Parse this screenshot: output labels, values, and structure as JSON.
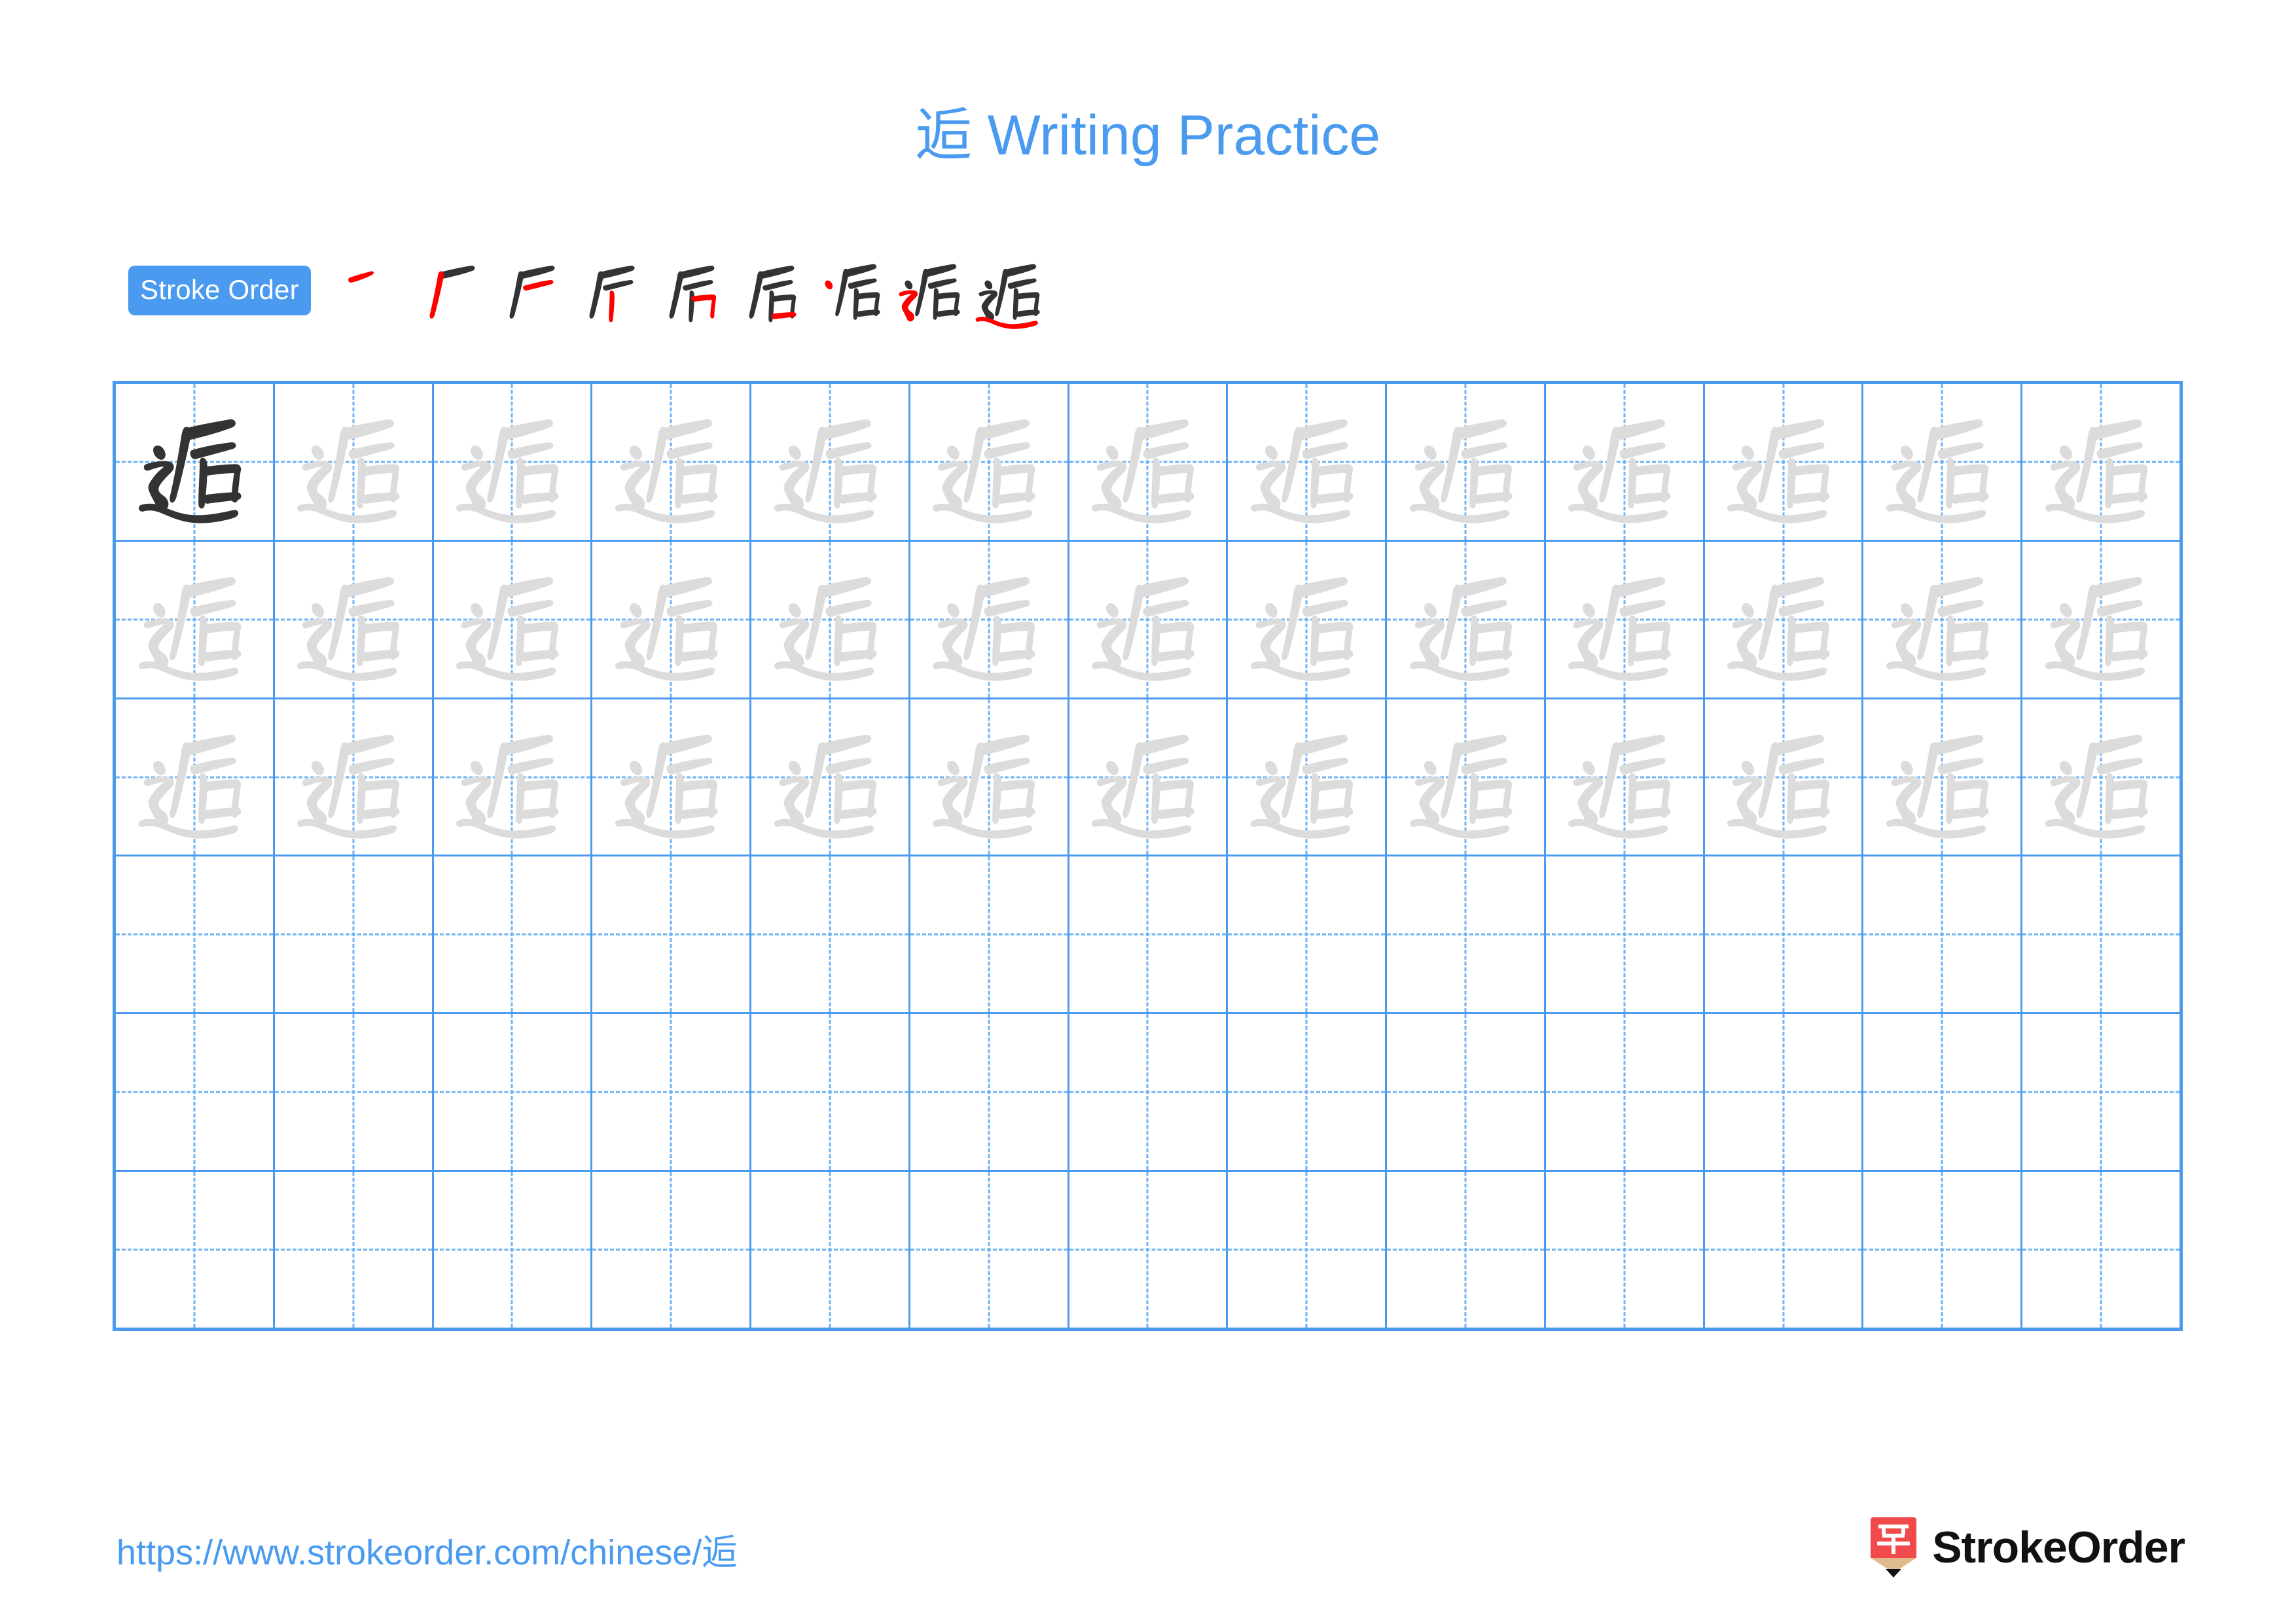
{
  "page": {
    "character": "逅",
    "title_suffix": " Writing Practice",
    "title_full": "逅 Writing Practice",
    "accent_color": "#4a9bf0",
    "grid_line_color": "#4a9bf0",
    "grid_guide_color": "#6fb3f5",
    "dark_stroke_color": "#333333",
    "trace_stroke_color": "#dcdcdc",
    "new_stroke_color": "#ff0000"
  },
  "stroke_order": {
    "badge_label": "Stroke Order",
    "total_strokes": 9,
    "steps": [
      {
        "index": 1,
        "stroke_name": "dian",
        "partial": "丿"
      },
      {
        "index": 2,
        "stroke_name": "pie",
        "partial": "厂"
      },
      {
        "index": 3,
        "stroke_name": "heng",
        "partial": "厂"
      },
      {
        "index": 4,
        "stroke_name": "shu",
        "partial": "斤"
      },
      {
        "index": 5,
        "stroke_name": "heng-zhe",
        "partial": "后"
      },
      {
        "index": 6,
        "stroke_name": "heng",
        "partial": "后"
      },
      {
        "index": 7,
        "stroke_name": "dian",
        "partial": "辶后"
      },
      {
        "index": 8,
        "stroke_name": "heng-zhe-zhe-pie",
        "partial": "辶后"
      },
      {
        "index": 9,
        "stroke_name": "na",
        "partial": "逅"
      }
    ]
  },
  "practice_grid": {
    "columns": 13,
    "rows": 6,
    "rows_data": [
      {
        "row": 1,
        "cells": [
          "dark",
          "trace",
          "trace",
          "trace",
          "trace",
          "trace",
          "trace",
          "trace",
          "trace",
          "trace",
          "trace",
          "trace",
          "trace"
        ]
      },
      {
        "row": 2,
        "cells": [
          "trace",
          "trace",
          "trace",
          "trace",
          "trace",
          "trace",
          "trace",
          "trace",
          "trace",
          "trace",
          "trace",
          "trace",
          "trace"
        ]
      },
      {
        "row": 3,
        "cells": [
          "trace",
          "trace",
          "trace",
          "trace",
          "trace",
          "trace",
          "trace",
          "trace",
          "trace",
          "trace",
          "trace",
          "trace",
          "trace"
        ]
      },
      {
        "row": 4,
        "cells": [
          "empty",
          "empty",
          "empty",
          "empty",
          "empty",
          "empty",
          "empty",
          "empty",
          "empty",
          "empty",
          "empty",
          "empty",
          "empty"
        ]
      },
      {
        "row": 5,
        "cells": [
          "empty",
          "empty",
          "empty",
          "empty",
          "empty",
          "empty",
          "empty",
          "empty",
          "empty",
          "empty",
          "empty",
          "empty",
          "empty"
        ]
      },
      {
        "row": 6,
        "cells": [
          "empty",
          "empty",
          "empty",
          "empty",
          "empty",
          "empty",
          "empty",
          "empty",
          "empty",
          "empty",
          "empty",
          "empty",
          "empty"
        ]
      }
    ]
  },
  "footer": {
    "url": "https://www.strokeorder.com/chinese/逅",
    "brand_name": "StrokeOrder",
    "logo_character": "字",
    "logo_body_color": "#f04a4a",
    "logo_tip_color": "#e0b98f",
    "logo_point_color": "#111111"
  }
}
